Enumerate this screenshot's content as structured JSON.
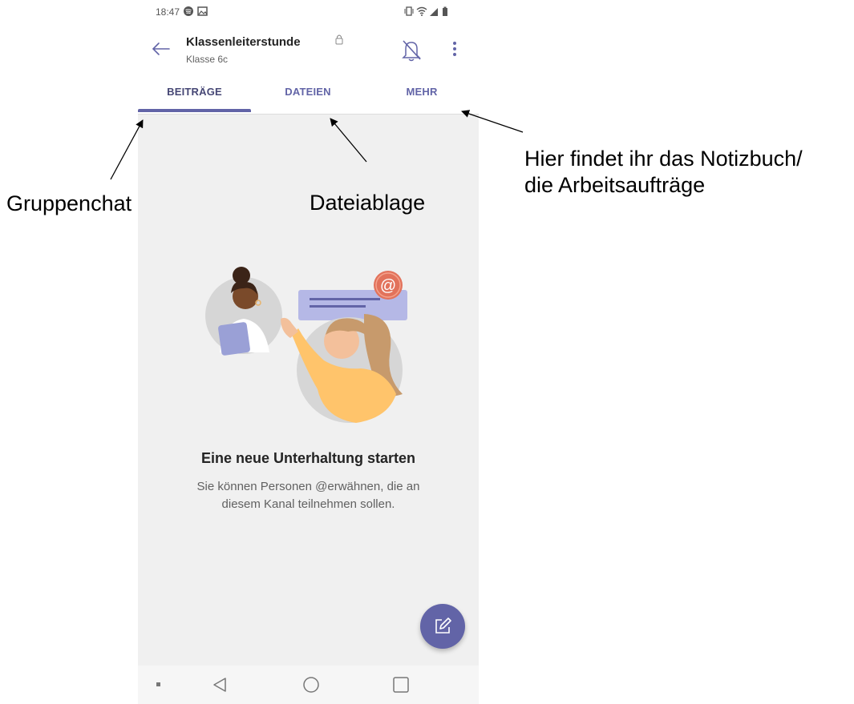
{
  "status_bar": {
    "time": "18:47",
    "left_icons": [
      "spotify-icon",
      "image-icon"
    ],
    "right_icons": [
      "vibrate-icon",
      "wifi-icon",
      "signal-icon",
      "battery-icon"
    ]
  },
  "channel": {
    "title": "Klassenleiterstunde",
    "subtitle": "Klasse 6c",
    "private_icon": "lock-icon"
  },
  "header_actions": {
    "back_icon": "arrow-left-icon",
    "mute_icon": "bell-off-icon",
    "more_icon": "more-vertical-icon"
  },
  "tabs": [
    {
      "label": "BEITRÄGE",
      "active": true
    },
    {
      "label": "DATEIEN",
      "active": false
    },
    {
      "label": "MEHR",
      "active": false
    }
  ],
  "empty_state": {
    "title": "Eine neue Unterhaltung starten",
    "description": "Sie können Personen @erwähnen, die an diesem Kanal teilnehmen sollen.",
    "mention_badge": "@"
  },
  "fab": {
    "icon": "compose-icon"
  },
  "nav_bar": [
    "dot-icon",
    "back-triangle-icon",
    "home-circle-icon",
    "recents-square-icon"
  ],
  "annotations": {
    "group_chat": "Gruppenchat",
    "file_storage": "Dateiablage",
    "more_line1": "Hier findet ihr das Notizbuch/",
    "more_line2": "die Arbeitsaufträge"
  },
  "colors": {
    "accent": "#6264a7",
    "accent_dark": "#464775",
    "background": "#f0f0f0",
    "mention_badge": "#e2725b"
  }
}
